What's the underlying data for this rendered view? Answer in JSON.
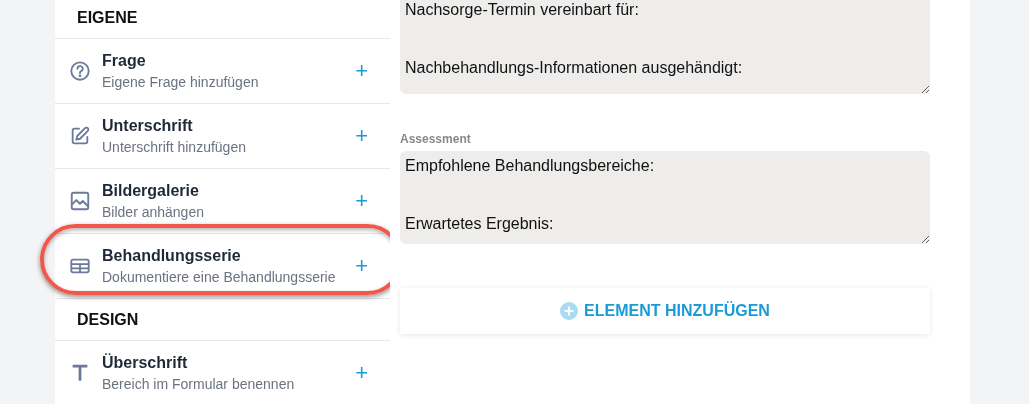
{
  "sidebar": {
    "sections": [
      {
        "heading": "EIGENE",
        "items": [
          {
            "kind": "question",
            "title": "Frage",
            "subtitle": "Eigene Frage hinzufügen",
            "add": "+",
            "highlighted": false
          },
          {
            "kind": "pencil",
            "title": "Unterschrift",
            "subtitle": "Unterschrift hinzufügen",
            "add": "+",
            "highlighted": false
          },
          {
            "kind": "image",
            "title": "Bildergalerie",
            "subtitle": "Bilder anhängen",
            "add": "+",
            "highlighted": false
          },
          {
            "kind": "table",
            "title": "Behandlungsserie",
            "subtitle": "Dokumentiere eine Behandlungsserie",
            "add": "+",
            "highlighted": true
          }
        ]
      },
      {
        "heading": "DESIGN",
        "items": [
          {
            "kind": "text",
            "title": "Überschrift",
            "subtitle": "Bereich im Formular benennen",
            "add": "+",
            "highlighted": false
          }
        ]
      }
    ]
  },
  "form": {
    "fields": [
      {
        "value": "Nachsorge-Termin vereinbart für:\n\n\nNachbehandlungs-Informationen ausgehändigt:"
      },
      {
        "label": "Assessment",
        "value": "Empfohlene Behandlungsbereiche:\n\n\nErwartetes Ergebnis:"
      }
    ],
    "add_button": "ELEMENT HINZUFÜGEN"
  }
}
